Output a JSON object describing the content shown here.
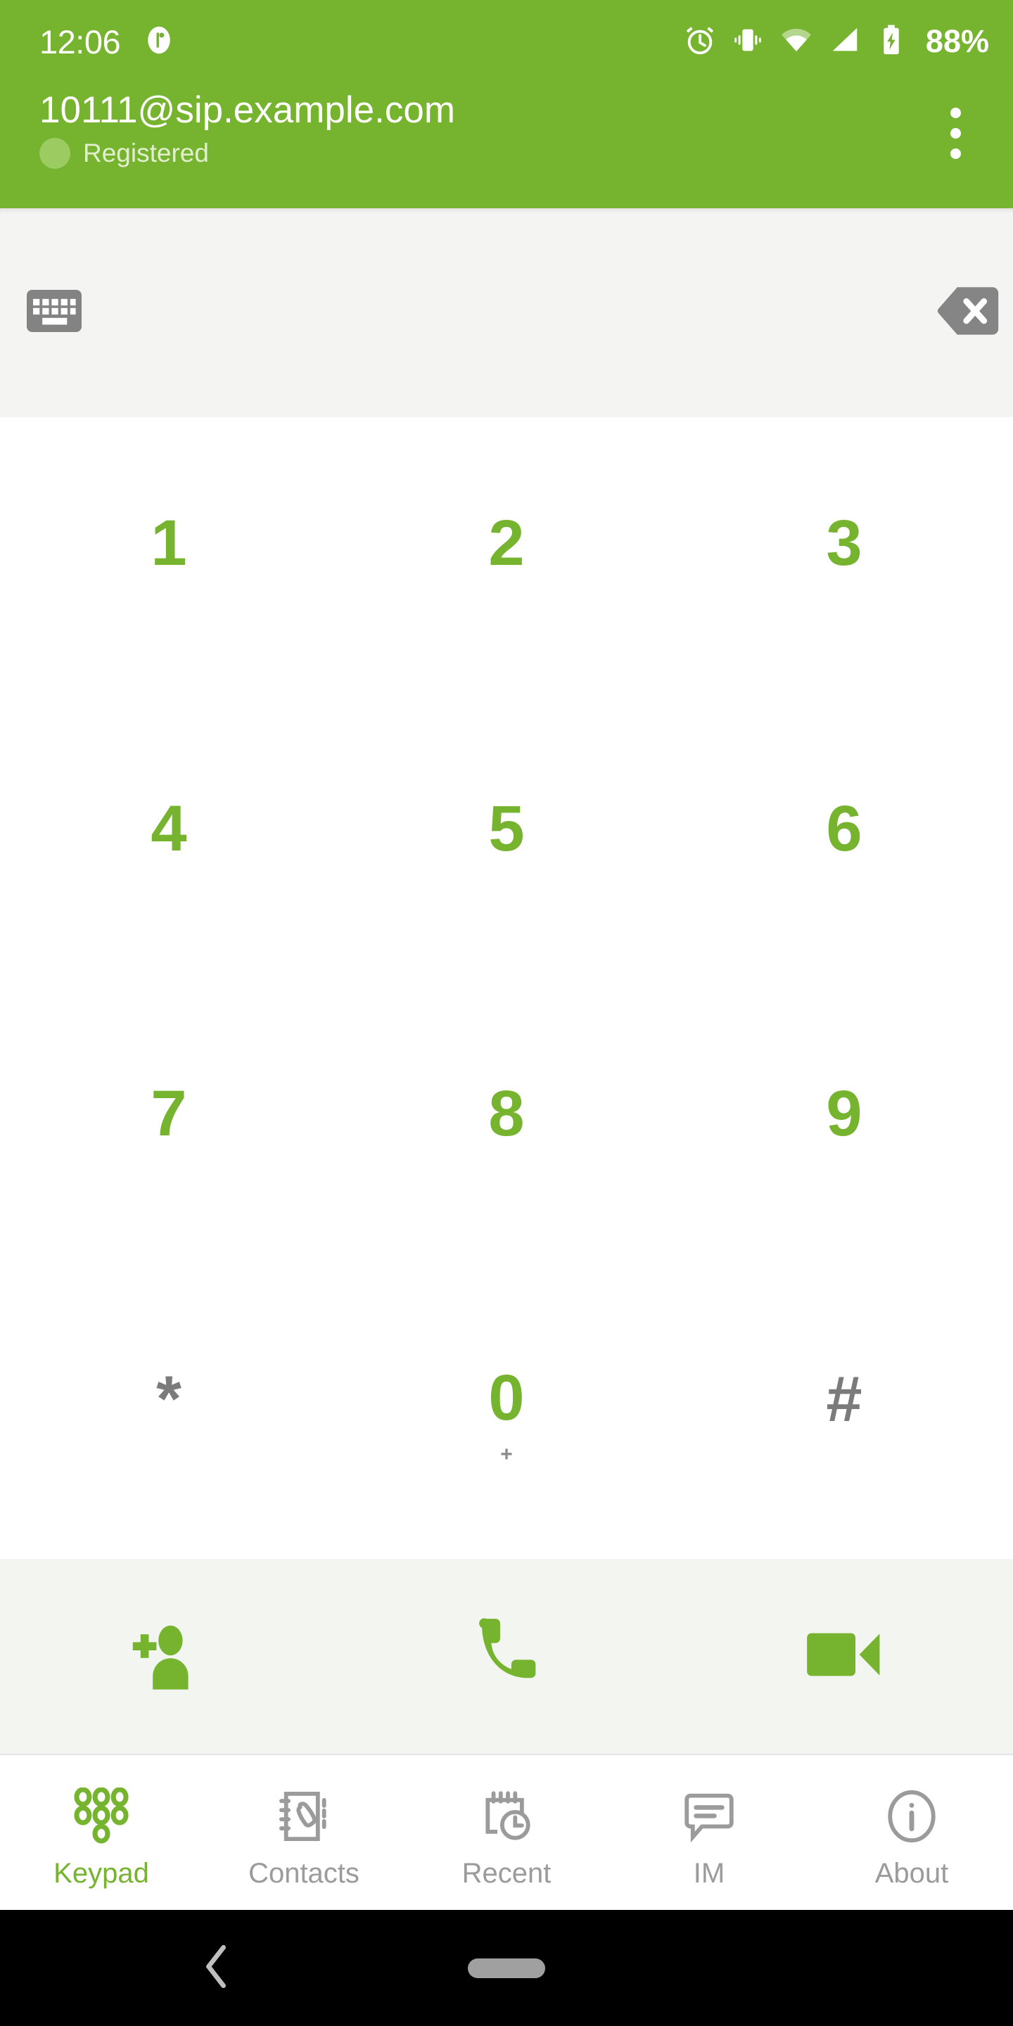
{
  "status_bar": {
    "time": "12:06",
    "battery_percent": "88%",
    "icons": [
      "notification-dot-icon",
      "alarm-icon",
      "vibrate-icon",
      "wifi-icon",
      "cellular-signal-icon",
      "battery-charging-icon"
    ]
  },
  "app_header": {
    "sip_uri": "10111@sip.example.com",
    "registration_status": "Registered",
    "status_dot_color": "#9CCB62",
    "overflow_menu": "overflow-menu-icon",
    "background_color": "#76B32E"
  },
  "input_bar": {
    "keyboard_toggle": "keyboard-icon",
    "backspace": "backspace-icon",
    "dialed_number": "",
    "placeholder": "",
    "background_color": "#F4F5F3"
  },
  "keypad": {
    "accent_color": "#76B32E",
    "symbol_color": "#7B7B7B",
    "rows": [
      [
        {
          "main": "1",
          "sub": "",
          "style": "accent"
        },
        {
          "main": "2",
          "sub": "",
          "style": "accent"
        },
        {
          "main": "3",
          "sub": "",
          "style": "accent"
        }
      ],
      [
        {
          "main": "4",
          "sub": "",
          "style": "accent"
        },
        {
          "main": "5",
          "sub": "",
          "style": "accent"
        },
        {
          "main": "6",
          "sub": "",
          "style": "accent"
        }
      ],
      [
        {
          "main": "7",
          "sub": "",
          "style": "accent"
        },
        {
          "main": "8",
          "sub": "",
          "style": "accent"
        },
        {
          "main": "9",
          "sub": "",
          "style": "accent"
        }
      ],
      [
        {
          "main": "*",
          "sub": "",
          "style": "gray"
        },
        {
          "main": "0",
          "sub": "+",
          "style": "accent"
        },
        {
          "main": "#",
          "sub": "",
          "style": "gray"
        }
      ]
    ]
  },
  "action_bar": {
    "background_color": "#F3F5F1",
    "buttons": [
      {
        "name": "add-contact-button",
        "icon": "add-person-icon"
      },
      {
        "name": "audio-call-button",
        "icon": "phone-icon"
      },
      {
        "name": "video-call-button",
        "icon": "video-camera-icon"
      }
    ]
  },
  "bottom_nav": {
    "active_color": "#76B32E",
    "inactive_color": "#9B9B9B",
    "items": [
      {
        "label": "Keypad",
        "icon": "dialpad-icon",
        "active": true
      },
      {
        "label": "Contacts",
        "icon": "address-book-icon",
        "active": false
      },
      {
        "label": "Recent",
        "icon": "call-history-icon",
        "active": false
      },
      {
        "label": "IM",
        "icon": "chat-bubble-icon",
        "active": false
      },
      {
        "label": "About",
        "icon": "info-circle-icon",
        "active": false
      }
    ]
  },
  "android_nav": {
    "back": "back-chevron-icon",
    "home": "home-pill-icon"
  }
}
